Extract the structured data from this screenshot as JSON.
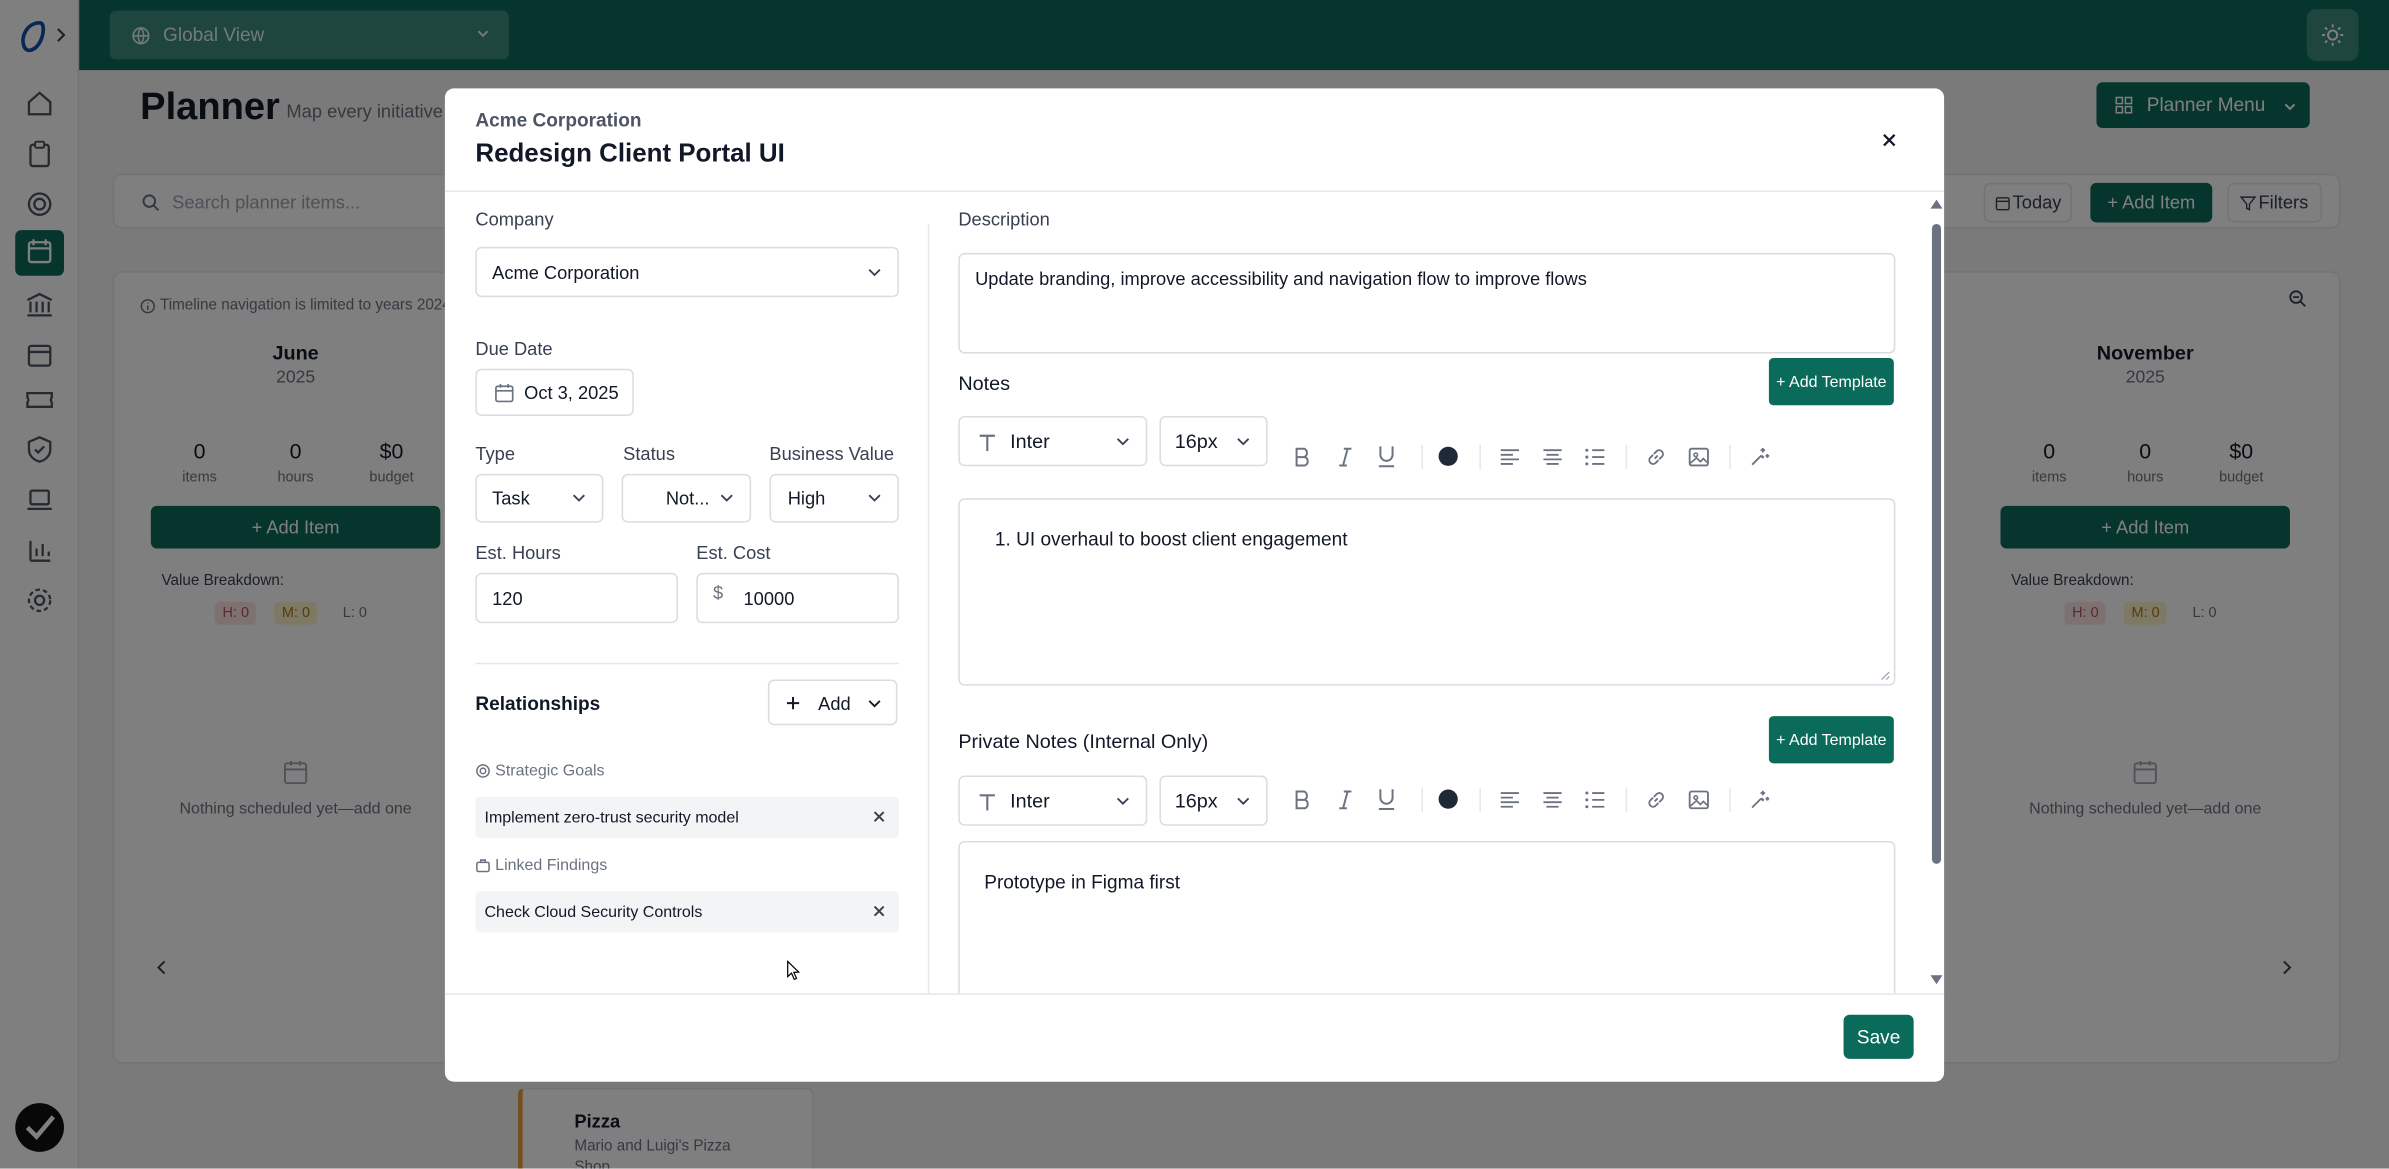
{
  "app": {
    "global_view": "Global View",
    "page_title": "Planner",
    "page_subtitle": "Map every initiative",
    "planner_menu": "Planner Menu",
    "search_placeholder": "Search planner items...",
    "today": "Today",
    "add_item": "+ Add Item",
    "filters": "Filters",
    "timeline_note": "Timeline navigation is limited to years 2024",
    "months": [
      {
        "name": "June",
        "year": "2025",
        "items": "0",
        "hours": "0",
        "budget": "$0"
      },
      {
        "name": "November",
        "year": "2025",
        "items": "0",
        "hours": "0",
        "budget": "$0"
      }
    ],
    "stat_labels": {
      "items": "items",
      "hours": "hours",
      "budget": "budget"
    },
    "month_add": "+ Add Item",
    "value_breakdown": "Value Breakdown:",
    "pills": {
      "h": "H: 0",
      "m": "M: 0",
      "l": "L: 0"
    },
    "empty_text": "Nothing scheduled yet—add one",
    "pizza": {
      "title": "Pizza",
      "sub": "Mario and Luigi's Pizza",
      "sub2": "Shop"
    }
  },
  "modal": {
    "company_header": "Acme Corporation",
    "title": "Redesign Client Portal UI",
    "company_label": "Company",
    "company_value": "Acme Corporation",
    "due_label": "Due Date",
    "due_value": "Oct 3, 2025",
    "type_label": "Type",
    "type_value": "Task",
    "status_label": "Status",
    "status_value": "Not...",
    "bv_label": "Business Value",
    "bv_value": "High",
    "hours_label": "Est. Hours",
    "hours_value": "120",
    "cost_label": "Est. Cost",
    "cost_currency": "$",
    "cost_value": "10000",
    "relationships_label": "Relationships",
    "add_label": "Add",
    "goals_label": "Strategic Goals",
    "goal_item": "Implement zero-trust security model",
    "findings_label": "Linked Findings",
    "finding_item": "Check Cloud Security Controls",
    "description_label": "Description",
    "description_value": "Update branding, improve accessibility and navigation flow to improve flows",
    "notes_label": "Notes",
    "add_template": "+ Add Template",
    "font_value": "Inter",
    "size_value": "16px",
    "notes_item_number": "1.",
    "notes_item": "UI overhaul to boost client engagement",
    "private_label": "Private Notes (Internal Only)",
    "private_text": "Prototype in Figma first",
    "save": "Save"
  },
  "colors": {
    "brand": "#0b6b5a",
    "overlay": "rgba(0,0,0,0.5)",
    "pill_h": "#fde2e2",
    "pill_m": "#fdf3c8"
  }
}
